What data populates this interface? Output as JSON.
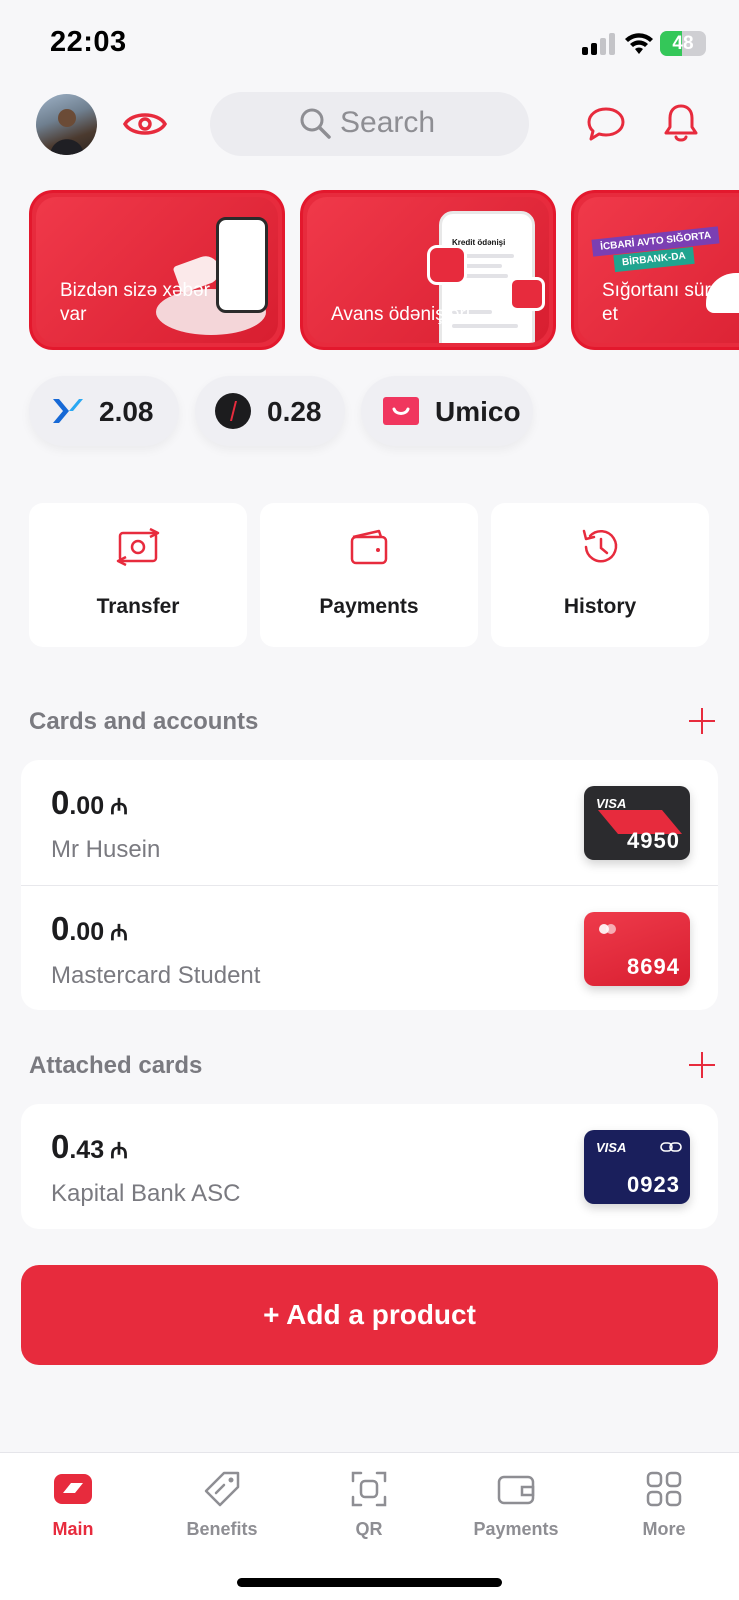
{
  "status_bar": {
    "time": "22:03",
    "battery": "48",
    "battery_level": 0.48
  },
  "header": {
    "search_placeholder": "Search",
    "icons": [
      "avatar",
      "eye-icon",
      "search-icon",
      "chat-icon",
      "bell-icon"
    ]
  },
  "banners": [
    {
      "title": "Bizdən sizə xəbər var"
    },
    {
      "title": "Avans ödənişləri",
      "phone_title": "Kredit ödənişi"
    },
    {
      "title": "Sığortanı sürətlə et",
      "tag1": "İCBARİ AVTO SIĞORTA",
      "tag2": "BİRBANK-DA"
    }
  ],
  "chips": [
    {
      "value": "2.08",
      "icon": "cashback-icon"
    },
    {
      "value": "0.28",
      "icon": "miles-icon"
    },
    {
      "value": "Umico",
      "icon": "umico-icon"
    }
  ],
  "actions": [
    {
      "label": "Transfer",
      "icon": "transfer-icon"
    },
    {
      "label": "Payments",
      "icon": "wallet-icon"
    },
    {
      "label": "History",
      "icon": "history-icon"
    }
  ],
  "cards_section": {
    "title": "Cards and accounts",
    "accounts": [
      {
        "balance_int": "0",
        "balance_dec": ".00",
        "currency": "₼",
        "name": "Mr Husein",
        "card_brand": "VISA",
        "card_last4": "4950",
        "card_color": "#2b2b2e"
      },
      {
        "balance_int": "0",
        "balance_dec": ".00",
        "currency": "₼",
        "name": "Mastercard Student",
        "card_brand": "",
        "card_last4": "8694",
        "card_color": "#e72b3d"
      }
    ]
  },
  "attached_section": {
    "title": "Attached cards",
    "accounts": [
      {
        "balance_int": "0",
        "balance_dec": ".43",
        "currency": "₼",
        "name": "Kapital Bank ASC",
        "card_brand": "VISA",
        "card_last4": "0923",
        "card_color": "#1a1f5c"
      }
    ]
  },
  "add_product_label": "+ Add a product",
  "tabbar": {
    "tabs": [
      {
        "label": "Main",
        "icon": "home-icon",
        "active": true
      },
      {
        "label": "Benefits",
        "icon": "tag-icon",
        "active": false
      },
      {
        "label": "QR",
        "icon": "qr-scan-icon",
        "active": false
      },
      {
        "label": "Payments",
        "icon": "wallet-icon",
        "active": false
      },
      {
        "label": "More",
        "icon": "grid-icon",
        "active": false
      }
    ]
  },
  "colors": {
    "accent": "#e72b3d",
    "text": "#1c1c1e",
    "muted": "#7a7a80",
    "background": "#f7f7f9"
  }
}
